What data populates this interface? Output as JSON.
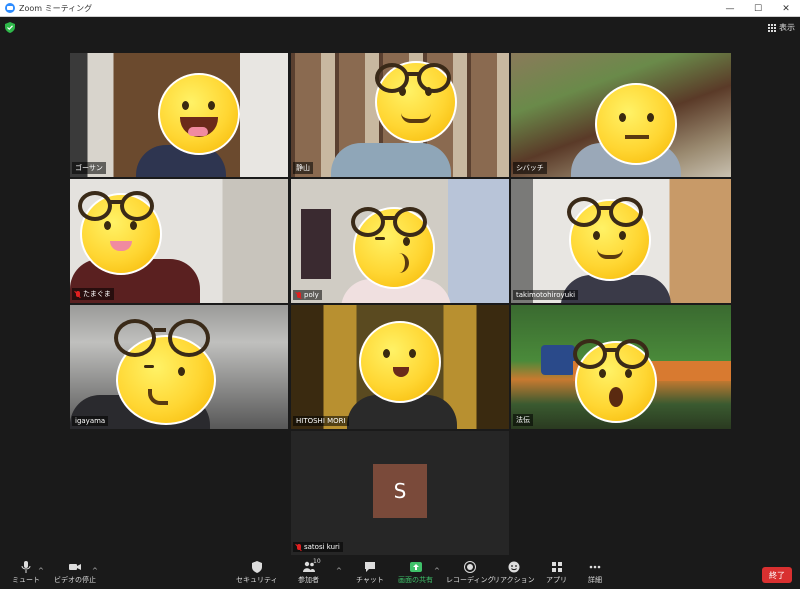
{
  "window": {
    "title": "Zoom ミーティング",
    "minimize": "—",
    "maximize": "☐",
    "close": "✕"
  },
  "topbar": {
    "view_label": "表示"
  },
  "participants": [
    {
      "name": "ゴーサン",
      "muted": false
    },
    {
      "name": "静山",
      "muted": false
    },
    {
      "name": "シバッチ",
      "muted": false,
      "speaking": true
    },
    {
      "name": "たまぐま",
      "muted": true
    },
    {
      "name": "poly",
      "muted": true
    },
    {
      "name": "takimotohiroyuki",
      "muted": false
    },
    {
      "name": "igayama",
      "muted": false
    },
    {
      "name": "HITOSHI MORI",
      "muted": false
    },
    {
      "name": "法伝",
      "muted": false
    },
    {
      "name": "satosi kuri",
      "muted": true,
      "initial": "S"
    }
  ],
  "toolbar": {
    "mute": "ミュート",
    "video": "ビデオの停止",
    "security": "セキュリティ",
    "participants": "参加者",
    "participants_count": "10",
    "chat": "チャット",
    "share": "画面の共有",
    "record": "レコーディング",
    "reactions": "リアクション",
    "apps": "アプリ",
    "more": "詳細",
    "end": "終了"
  },
  "colors": {
    "share_green": "#3fc26a",
    "end_red": "#d93030",
    "active_border": "#f0e060",
    "zoom_blue": "#2d8cff"
  }
}
